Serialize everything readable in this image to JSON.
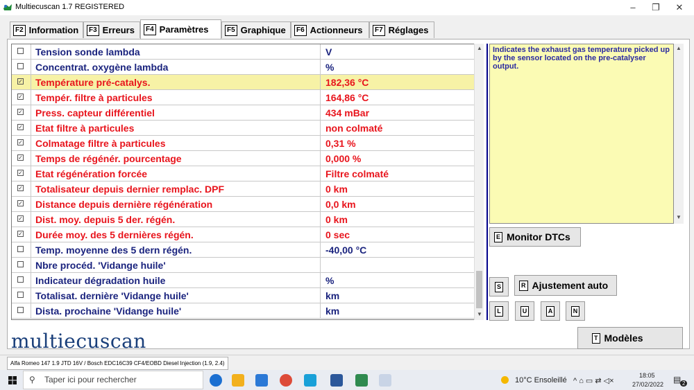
{
  "window": {
    "title": "Multiecuscan 1.7 REGISTERED"
  },
  "tabs": [
    {
      "key": "F2",
      "label": "Information"
    },
    {
      "key": "F3",
      "label": "Erreurs"
    },
    {
      "key": "F4",
      "label": "Paramètres"
    },
    {
      "key": "F5",
      "label": "Graphique"
    },
    {
      "key": "F6",
      "label": "Actionneurs"
    },
    {
      "key": "F7",
      "label": "Réglages"
    }
  ],
  "active_tab": "Paramètres",
  "parameters": [
    {
      "name": "Tension sonde lambda",
      "value": "V",
      "checked": false
    },
    {
      "name": "Concentrat. oxygène lambda",
      "value": "%",
      "checked": false
    },
    {
      "name": "Température pré-catalys.",
      "value": "182,36 °C",
      "checked": true
    },
    {
      "name": "Tempér. filtre à particules",
      "value": "164,86 °C",
      "checked": true
    },
    {
      "name": "Press. capteur différentiel",
      "value": "434 mBar",
      "checked": true
    },
    {
      "name": "Etat filtre à particules",
      "value": "non colmaté",
      "checked": true
    },
    {
      "name": "Colmatage filtre  à particules",
      "value": "0,31 %",
      "checked": true
    },
    {
      "name": "Temps de régénér. pourcentage",
      "value": "0,000 %",
      "checked": true
    },
    {
      "name": "Etat régénération forcée",
      "value": "Filtre colmaté",
      "checked": true
    },
    {
      "name": "Totalisateur depuis dernier remplac. DPF",
      "value": "0 km",
      "checked": true
    },
    {
      "name": "Distance depuis dernière régénération",
      "value": "0,0 km",
      "checked": true
    },
    {
      "name": "Dist. moy. depuis 5 der. régén.",
      "value": "0 km",
      "checked": true
    },
    {
      "name": "Durée moy. des 5 dernières régén.",
      "value": "0 sec",
      "checked": true
    },
    {
      "name": "Temp. moyenne des 5 dern régén.",
      "value": "-40,00 °C",
      "checked": false
    },
    {
      "name": "Nbre procéd. 'Vidange huile'",
      "value": "",
      "checked": false
    },
    {
      "name": "Indicateur dégradation huile",
      "value": "%",
      "checked": false
    },
    {
      "name": "Totalisat. dernière 'Vidange huile'",
      "value": "km",
      "checked": false
    },
    {
      "name": "Dista. prochaine 'Vidange huile'",
      "value": "km",
      "checked": false
    }
  ],
  "selected_row": 2,
  "colors": {
    "checked_text": "#e8141c",
    "unchecked_text": "#1a237e",
    "selected_bg": "#f7f2a6"
  },
  "description": "Indicates the exhaust gas temperature picked up by the sensor located on the pre-catalyser output.",
  "buttons": {
    "monitor": {
      "key": "E",
      "label": "Monitor DTCs"
    },
    "s": {
      "key": "S"
    },
    "ajustement": {
      "key": "R",
      "label": "Ajustement auto"
    },
    "l": {
      "key": "L"
    },
    "u": {
      "key": "U"
    },
    "a": {
      "key": "A"
    },
    "n": {
      "key": "N"
    },
    "modeles": {
      "key": "T",
      "label": "Modèles"
    }
  },
  "logo": "multiecuscan",
  "status": "Alfa Romeo 147 1.9 JTD 16V / Bosch EDC16C39 CF4/EOBD Diesel Injection (1.9, 2.4)",
  "taskbar": {
    "search_placeholder": "Taper ici pour rechercher",
    "weather": "10°C  Ensoleillé",
    "time": "18:05",
    "date": "27/02/2022",
    "notification_count": "2"
  }
}
